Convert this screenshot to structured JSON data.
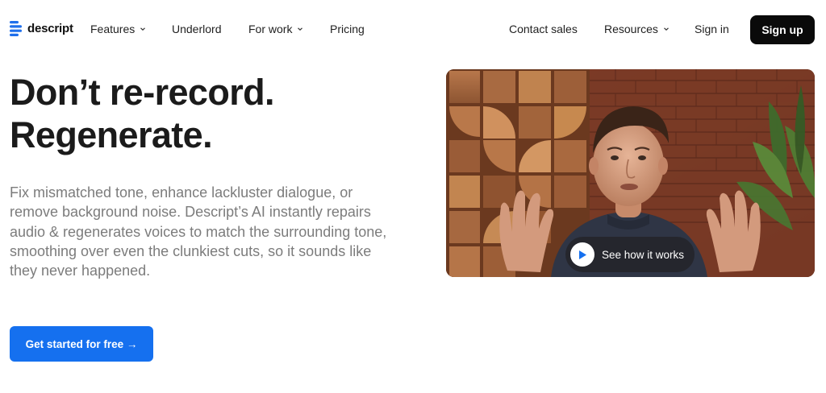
{
  "brand": {
    "name": "descript"
  },
  "nav": {
    "left_items": [
      {
        "label": "Features",
        "has_dropdown": true
      },
      {
        "label": "Underlord",
        "has_dropdown": false
      },
      {
        "label": "For work",
        "has_dropdown": true
      },
      {
        "label": "Pricing",
        "has_dropdown": false
      }
    ],
    "right_items": [
      {
        "label": "Contact sales",
        "has_dropdown": false
      },
      {
        "label": "Resources",
        "has_dropdown": true
      },
      {
        "label": "Sign in",
        "has_dropdown": false
      }
    ],
    "signup_label": "Sign up"
  },
  "hero": {
    "headline_line1": "Don’t re-record.",
    "headline_line2": "Regenerate.",
    "subtext": "Fix mismatched tone, enhance lackluster dialogue, or remove background noise. Descript’s AI instantly repairs audio & regenerates voices to match the surrounding tone, smoothing over even the clunkiest cuts, so it sounds like they never happened.",
    "cta_label": "Get started for free →"
  },
  "video": {
    "button_label": "See how it works"
  },
  "colors": {
    "brand_blue": "#1570ef",
    "signup_bg": "#0a0a0a",
    "text_dark": "#1b1b1b",
    "text_muted": "#7c7c7c"
  },
  "icons": [
    "descript-logo-icon",
    "chevron-down-icon",
    "play-icon"
  ]
}
